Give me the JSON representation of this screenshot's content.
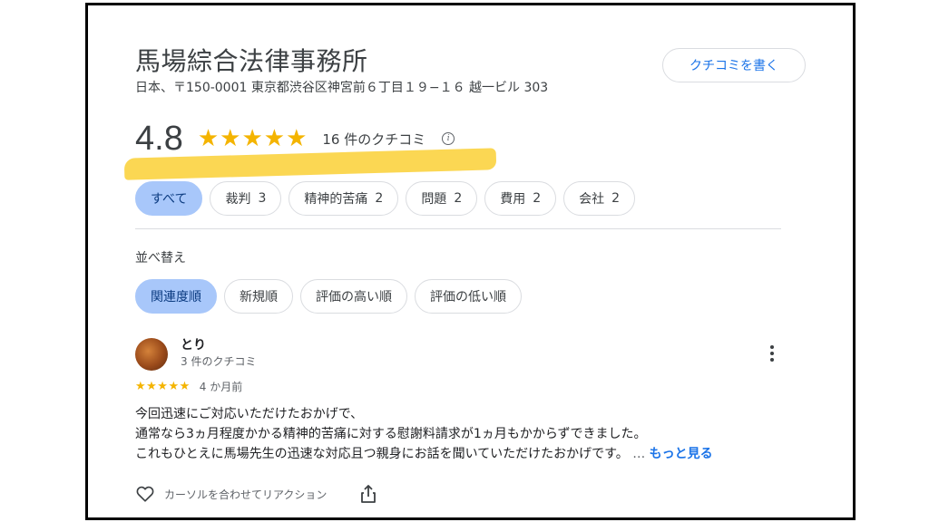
{
  "business": {
    "name": "馬場綜合法律事務所",
    "address": "日本、〒150-0001 東京都渋谷区神宮前６丁目１９−１６ 越一ビル 303",
    "write_review_label": "クチコミを書く"
  },
  "rating": {
    "value": "4.8",
    "stars_display": "★★★★★",
    "stars": 5,
    "review_count": "16 件のクチコミ",
    "info_icon": "info-icon"
  },
  "topics": [
    {
      "label": "すべて",
      "count": "",
      "selected": true
    },
    {
      "label": "裁判",
      "count": "3",
      "selected": false
    },
    {
      "label": "精神的苦痛",
      "count": "2",
      "selected": false
    },
    {
      "label": "問題",
      "count": "2",
      "selected": false
    },
    {
      "label": "費用",
      "count": "2",
      "selected": false
    },
    {
      "label": "会社",
      "count": "2",
      "selected": false
    }
  ],
  "sort": {
    "label": "並べ替え",
    "options": [
      {
        "label": "関連度順",
        "selected": true
      },
      {
        "label": "新規順",
        "selected": false
      },
      {
        "label": "評価の高い順",
        "selected": false
      },
      {
        "label": "評価の低い順",
        "selected": false
      }
    ]
  },
  "review": {
    "reviewer_name": "とり",
    "reviewer_sub": "3 件のクチコミ",
    "stars_display": "★★★★★",
    "stars": 5,
    "time": "4 か月前",
    "text_lines": [
      "今回迅速にご対応いただけたおかげで、",
      "通常なら3ヵ月程度かかる精神的苦痛に対する慰謝料請求が1ヵ月もかからずできました。",
      "これもひとえに馬場先生の迅速な対応且つ親身にお話を聞いていただけたおかげです。"
    ],
    "ellipsis": "…",
    "more_label": "もっと見る",
    "reaction_label": "カーソルを合わせてリアクション"
  },
  "colors": {
    "star": "#f4b400",
    "accent_blue": "#1a73e8",
    "chip_selected_bg": "#a8c7fa",
    "highlight": "#fbd54a"
  }
}
